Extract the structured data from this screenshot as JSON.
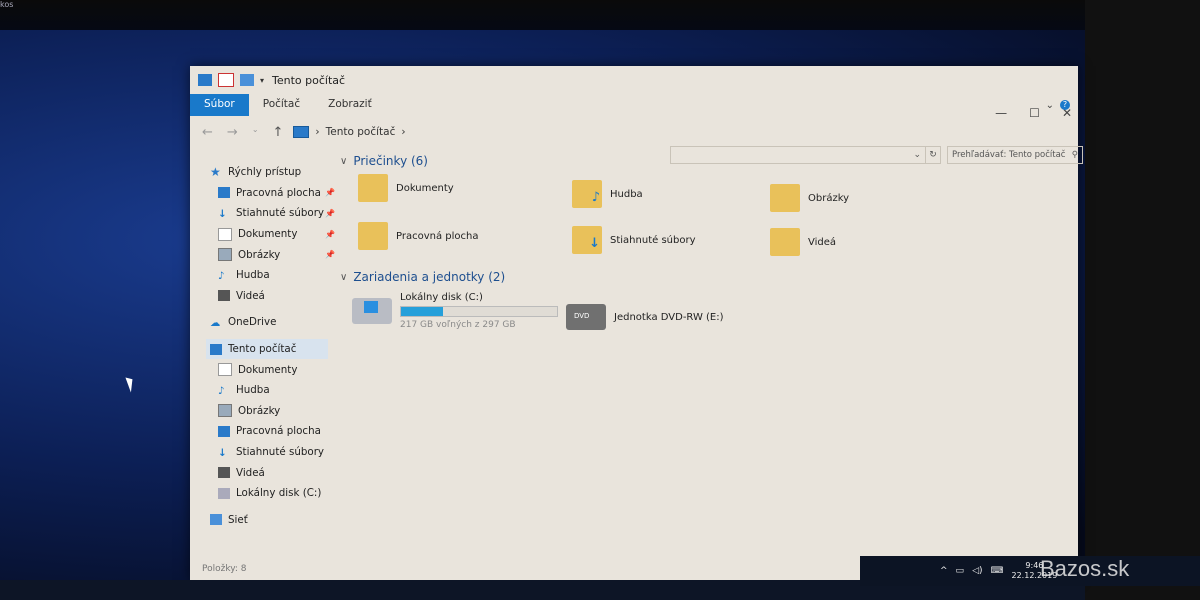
{
  "corner_text": "kos",
  "window": {
    "title": "Tento počítač",
    "controls": [
      "—",
      "☐",
      "✕"
    ]
  },
  "ribbon": {
    "tabs": [
      "Súbor",
      "Počítač",
      "Zobraziť"
    ],
    "expand": "⌄",
    "help": "?"
  },
  "address": {
    "location": "Tento počítač",
    "separator": "›",
    "search_placeholder": "Prehľadávať: Tento počítač"
  },
  "sidebar": {
    "quick_access": "Rýchly prístup",
    "quick_items": [
      "Pracovná plocha",
      "Stiahnuté súbory",
      "Dokumenty",
      "Obrázky",
      "Hudba",
      "Videá"
    ],
    "onedrive": "OneDrive",
    "this_pc": "Tento počítač",
    "pc_items": [
      "Dokumenty",
      "Hudba",
      "Obrázky",
      "Pracovná plocha",
      "Stiahnuté súbory",
      "Videá",
      "Lokálny disk (C:)"
    ],
    "network": "Sieť"
  },
  "content": {
    "folders_header": "Priečinky (6)",
    "folders": [
      "Dokumenty",
      "Hudba",
      "Obrázky",
      "Pracovná plocha",
      "Stiahnuté súbory",
      "Videá"
    ],
    "devices_header": "Zariadenia a jednotky (2)",
    "drive_c": {
      "name": "Lokálny disk (C:)",
      "free_text": "217 GB voľných z 297 GB",
      "used_fraction": 0.27
    },
    "drive_e": {
      "name": "Jednotka DVD-RW (E:)",
      "badge": "DVD"
    }
  },
  "status": "Položky: 8",
  "tray": {
    "time": "9:46",
    "date": "22.12.2019"
  },
  "watermark": "Bazos.sk"
}
